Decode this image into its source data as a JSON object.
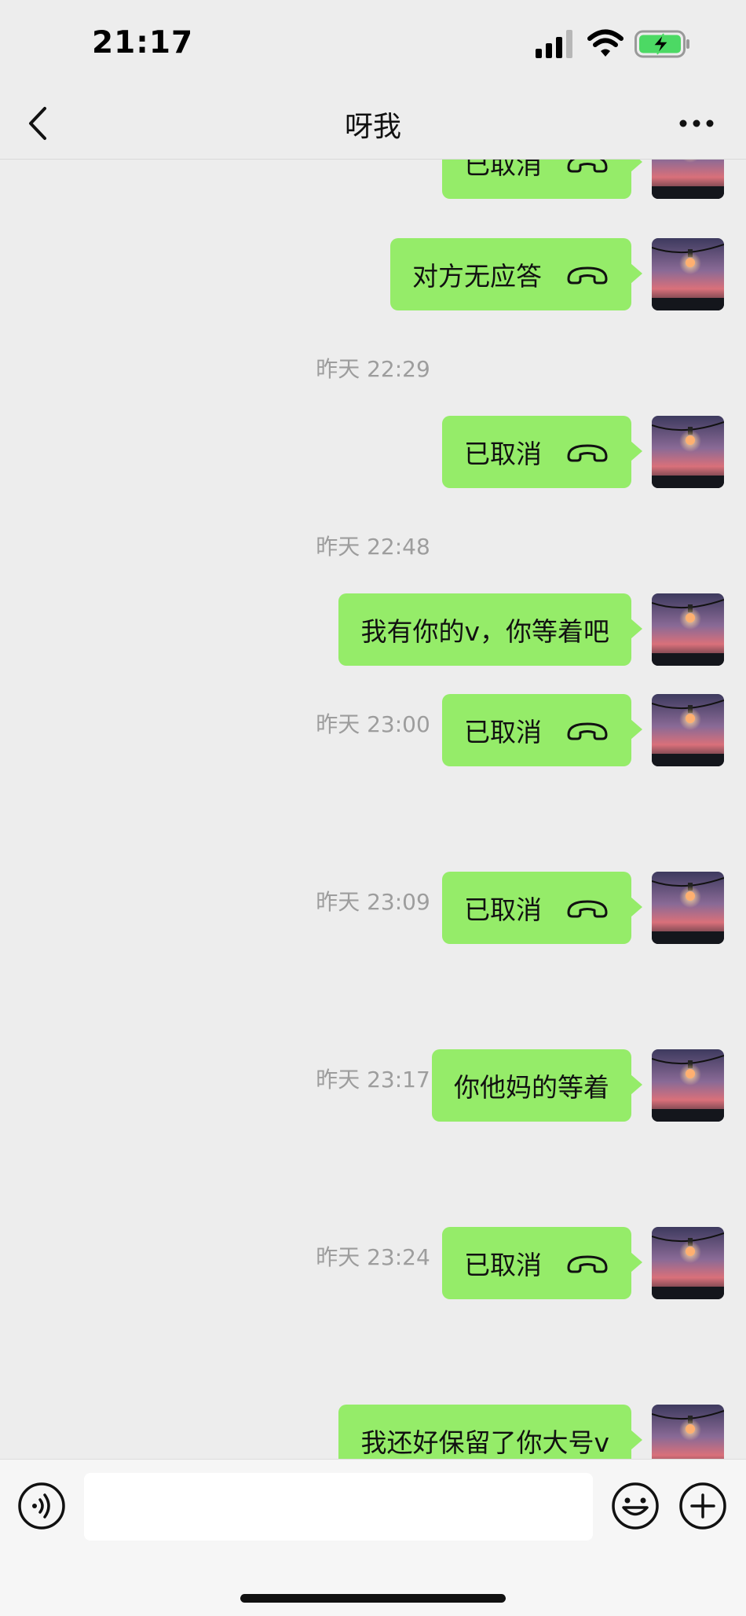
{
  "status_bar": {
    "time": "21:17",
    "signal_icon": "cellular-signal-icon",
    "wifi_icon": "wifi-icon",
    "battery_icon": "battery-charging-icon"
  },
  "nav": {
    "title": "呀我",
    "back_icon": "chevron-left-icon",
    "more_icon": "more-dots-icon"
  },
  "messages": [
    {
      "kind": "bubble",
      "text": "已取消",
      "call_icon": true
    },
    {
      "kind": "bubble",
      "text": "对方无应答",
      "call_icon": true
    },
    {
      "kind": "time",
      "text": "昨天 22:29"
    },
    {
      "kind": "bubble",
      "text": "已取消",
      "call_icon": true
    },
    {
      "kind": "time",
      "text": "昨天 22:48"
    },
    {
      "kind": "bubble",
      "text": "我有你的v，你等着吧",
      "call_icon": false
    },
    {
      "kind": "bubble",
      "text": "已取消",
      "call_icon": true
    },
    {
      "kind": "time",
      "text": "昨天 23:00"
    },
    {
      "kind": "bubble",
      "text": "已取消",
      "call_icon": true
    },
    {
      "kind": "time",
      "text": "昨天 23:09"
    },
    {
      "kind": "bubble",
      "text": "你他妈的等着",
      "call_icon": false
    },
    {
      "kind": "time",
      "text": "昨天 23:17"
    },
    {
      "kind": "bubble",
      "text": "已取消",
      "call_icon": true
    },
    {
      "kind": "time",
      "text": "昨天 23:24"
    },
    {
      "kind": "bubble",
      "text": "我还好保留了你大号v",
      "call_icon": false
    }
  ],
  "input_bar": {
    "voice_icon": "voice-input-icon",
    "emoji_icon": "emoji-icon",
    "plus_icon": "plus-icon",
    "text_value": ""
  },
  "colors": {
    "bubble": "#95ec69",
    "background": "#ededed",
    "timestamp": "#9d9d9d",
    "battery_fill": "#4cd964"
  }
}
